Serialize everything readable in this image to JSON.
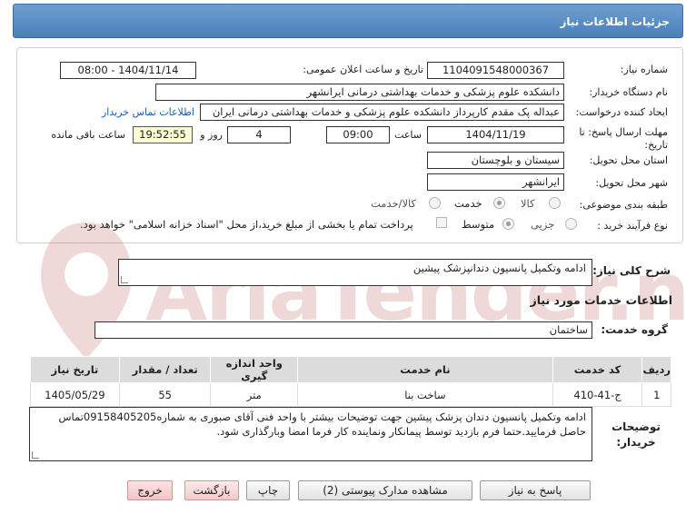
{
  "header": {
    "title": "جزئیات اطلاعات نیاز"
  },
  "form": {
    "need_number_label": "شماره نیاز:",
    "need_number": "1104091548000367",
    "announce_label": "تاریخ و ساعت اعلان عمومی:",
    "announce_value": "1404/11/14 - 08:00",
    "buyer_org_label": "نام دستگاه خریدار:",
    "buyer_org": "دانشکده علوم پزشکی و خدمات بهداشتی درمانی ایرانشهر",
    "creator_label": "ایجاد کننده درخواست:",
    "creator": "عبداله پک مقدم کارپرداز دانشکده علوم پزشکی و خدمات بهداشتی درمانی ایران",
    "contact_link": "اطلاعات تماس خریدار",
    "deadline_label": "مهلت ارسال پاسخ: تا تاریخ:",
    "deadline_date": "1404/11/19",
    "time_label": "ساعت",
    "deadline_time": "09:00",
    "days_value": "4",
    "days_label": "روز و",
    "remaining_time": "19:52:55",
    "remaining_label": "ساعت باقی مانده",
    "province_label": "استان محل تحویل:",
    "province": "سیستان و بلوچستان",
    "city_label": "شهر محل تحویل:",
    "city": "ایرانشهر",
    "category_label": "طبقه بندی موضوعی:",
    "category_options": [
      "کالا",
      "خدمت",
      "کالا/خدمت"
    ],
    "category_selected": "خدمت",
    "process_label": "نوع فرآیند خرید :",
    "process_options": [
      "جزیی",
      "متوسط"
    ],
    "process_selected": "متوسط",
    "payment_note": "پرداخت تمام یا بخشی از مبلغ خرید،از محل \"اسناد خزانه اسلامی\" خواهد بود."
  },
  "summary": {
    "label": "شرح کلی نیاز:",
    "value": "ادامه وتکمیل پانسیون دندانپزشک پیشین"
  },
  "services": {
    "heading": "اطلاعات خدمات مورد نیاز",
    "group_label": "گروه خدمت:",
    "group_value": "ساختمان",
    "columns": [
      "ردیف",
      "کد خدمت",
      "نام خدمت",
      "واحد اندازه گیری",
      "تعداد / مقدار",
      "تاریخ نیاز"
    ],
    "rows": [
      {
        "row": "1",
        "code": "ج-41-410",
        "name": "ساخت بنا",
        "unit": "متر",
        "qty": "55",
        "date": "1405/05/29"
      }
    ]
  },
  "notes": {
    "label": "توضیحات خریدار:",
    "text": "ادامه وتکمیل پانسیون دندان پزشک پیشین جهت توضیحات بیشتر با واحد فنی آقای صبوری به شماره09158405205تماس حاصل فرمایید.حتما فرم بازدید توسط پیمانکار ونماینده کار فرما امضا وبارگذاری شود."
  },
  "buttons": {
    "reply": "پاسخ به نیاز",
    "attachments": "مشاهده مدارک پیوستی (2)",
    "print": "چاپ",
    "back": "بازگشت",
    "exit": "خروج"
  },
  "watermark": {
    "text": "AriaTender.net"
  }
}
